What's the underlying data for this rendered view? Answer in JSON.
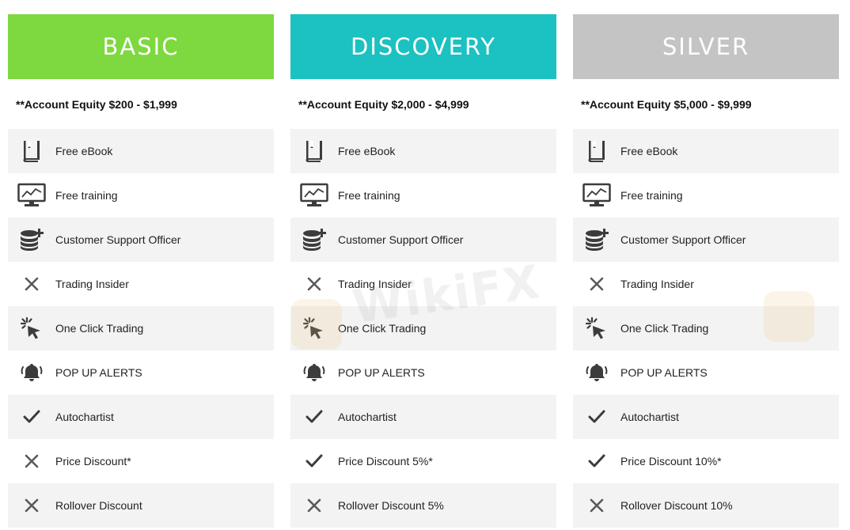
{
  "plans": [
    {
      "id": "basic",
      "name": "BASIC",
      "color": "#7ed83f",
      "equity": "**Account Equity $200 - $1,999",
      "features": [
        {
          "icon": "book-icon",
          "label": "Free eBook"
        },
        {
          "icon": "monitor-chart-icon",
          "label": "Free training"
        },
        {
          "icon": "coins-plus-icon",
          "label": "Customer Support Officer"
        },
        {
          "icon": "cross-icon",
          "label": "Trading Insider"
        },
        {
          "icon": "cursor-click-icon",
          "label": "One Click Trading"
        },
        {
          "icon": "bell-icon",
          "label": "POP UP ALERTS"
        },
        {
          "icon": "check-icon",
          "label": "Autochartist"
        },
        {
          "icon": "cross-icon",
          "label": "Price Discount*"
        },
        {
          "icon": "cross-icon",
          "label": "Rollover Discount"
        }
      ]
    },
    {
      "id": "discovery",
      "name": "DISCOVERY",
      "color": "#1cc1c1",
      "equity": "**Account Equity $2,000 - $4,999",
      "features": [
        {
          "icon": "book-icon",
          "label": "Free eBook"
        },
        {
          "icon": "monitor-chart-icon",
          "label": "Free training"
        },
        {
          "icon": "coins-plus-icon",
          "label": "Customer Support Officer"
        },
        {
          "icon": "cross-icon",
          "label": "Trading Insider"
        },
        {
          "icon": "cursor-click-icon",
          "label": "One Click Trading"
        },
        {
          "icon": "bell-icon",
          "label": "POP UP ALERTS"
        },
        {
          "icon": "check-icon",
          "label": "Autochartist"
        },
        {
          "icon": "check-icon",
          "label": "Price Discount 5%*"
        },
        {
          "icon": "cross-icon",
          "label": "Rollover Discount 5%"
        }
      ]
    },
    {
      "id": "silver",
      "name": "SILVER",
      "color": "#c4c4c4",
      "equity": "**Account Equity $5,000 - $9,999",
      "features": [
        {
          "icon": "book-icon",
          "label": "Free eBook"
        },
        {
          "icon": "monitor-chart-icon",
          "label": "Free training"
        },
        {
          "icon": "coins-plus-icon",
          "label": "Customer Support Officer"
        },
        {
          "icon": "cross-icon",
          "label": "Trading Insider"
        },
        {
          "icon": "cursor-click-icon",
          "label": "One Click Trading"
        },
        {
          "icon": "bell-icon",
          "label": "POP UP ALERTS"
        },
        {
          "icon": "check-icon",
          "label": "Autochartist"
        },
        {
          "icon": "check-icon",
          "label": "Price Discount 10%*"
        },
        {
          "icon": "cross-icon",
          "label": "Rollover Discount 10%"
        }
      ]
    }
  ],
  "watermark": "WikiFX"
}
